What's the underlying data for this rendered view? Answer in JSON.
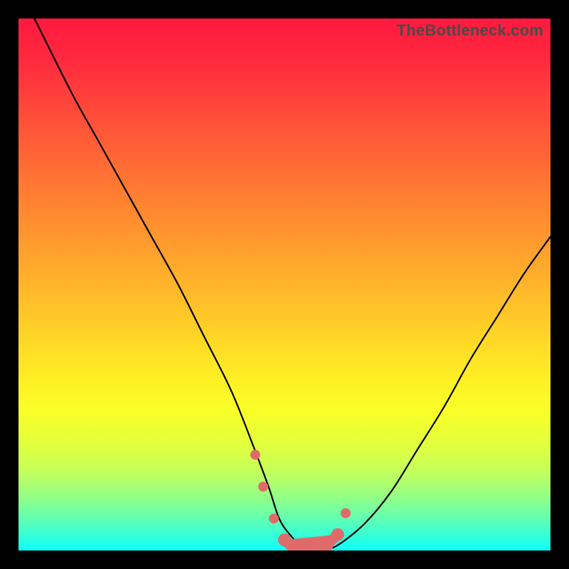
{
  "watermark": "TheBottleneck.com",
  "chart_data": {
    "type": "line",
    "title": "",
    "xlabel": "",
    "ylabel": "",
    "xlim": [
      0,
      100
    ],
    "ylim": [
      0,
      100
    ],
    "grid": false,
    "legend": false,
    "annotations": [],
    "series": [
      {
        "name": "bottleneck-curve",
        "x": [
          3,
          10,
          15,
          20,
          25,
          30,
          35,
          40,
          44,
          47,
          49,
          51,
          53,
          55,
          57,
          60,
          65,
          70,
          75,
          80,
          85,
          90,
          95,
          100
        ],
        "values": [
          100,
          86,
          77,
          68,
          59,
          50,
          40,
          30,
          20,
          12,
          6,
          3,
          1,
          0,
          0,
          1,
          5,
          11,
          19,
          27,
          36,
          44,
          52,
          59
        ]
      }
    ],
    "markers": {
      "name": "highlighted-points",
      "x": [
        44.5,
        46,
        48,
        50,
        52,
        54,
        56,
        58,
        60,
        61.5
      ],
      "values": [
        18,
        12,
        6,
        2,
        0,
        0,
        0,
        1,
        3,
        7
      ]
    }
  }
}
